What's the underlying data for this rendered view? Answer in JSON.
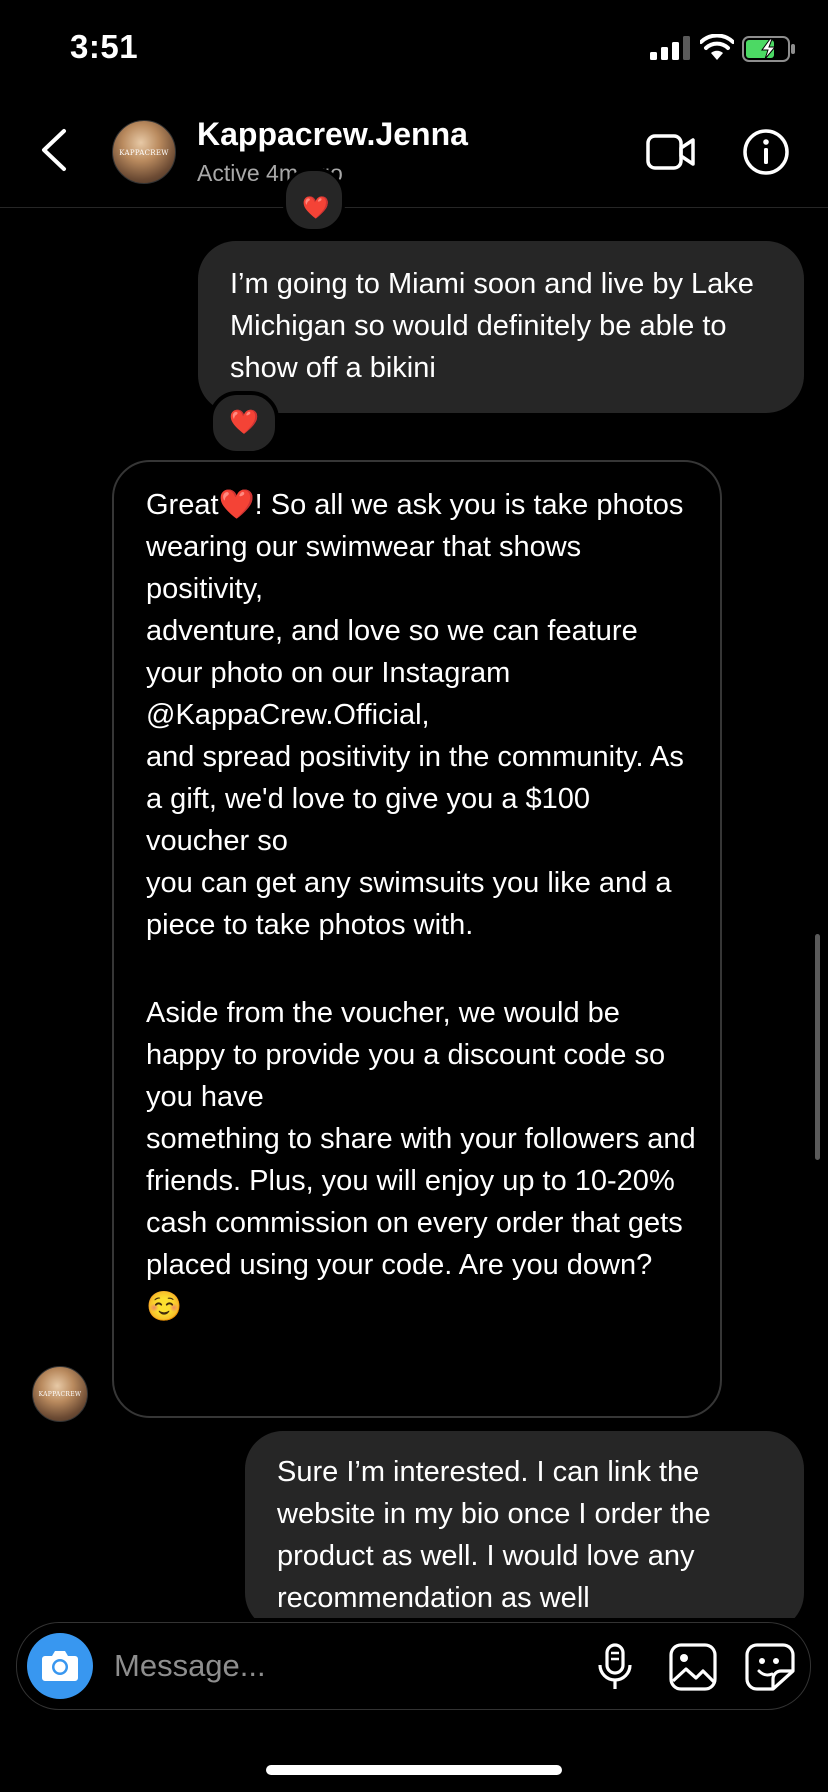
{
  "status_bar": {
    "time": "3:51"
  },
  "header": {
    "contact_name": "Kappacrew.Jenna",
    "contact_status": "Active 4m ago",
    "avatar_mark": "KAPPACREW"
  },
  "messages": {
    "sent_1": "I’m going to Miami soon and live by Lake Michigan so would definitely be able to show off a bikini",
    "reaction_1": "❤️",
    "received_1": {
      "paragraph_1": [
        "Great❤️! So all we ask you is take photos wearing our swimwear that shows positivity,",
        "adventure, and love so we can feature your photo on our Instagram @KappaCrew.Official,",
        "and spread positivity in the community. As a gift, we'd love to give you a $100 voucher so",
        "you can get any swimsuits you like and a piece to take photos with."
      ],
      "paragraph_2": [
        "Aside from the voucher, we would be happy to provide you a discount code so you have",
        "something to share with your followers and friends. Plus, you will enjoy up to 10-20%",
        "cash commission on every order that gets placed using your code. Are you down? ☺️"
      ]
    },
    "sent_2": "Sure I’m interested. I can link the website in my bio once I order the product as well. I would love any recommendation as well"
  },
  "composer": {
    "placeholder": "Message..."
  },
  "colors": {
    "camera_button": "#3897f0",
    "sent_bubble": "#262626",
    "battery": "#4cd964"
  },
  "icons": [
    "back-chevron-icon",
    "video-call-icon",
    "info-icon",
    "camera-icon",
    "microphone-icon",
    "image-icon",
    "sticker-icon"
  ]
}
